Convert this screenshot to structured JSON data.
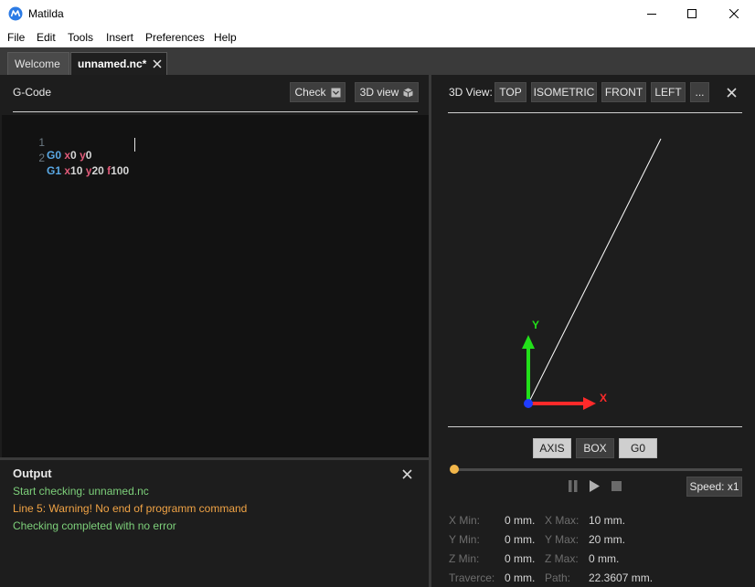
{
  "window": {
    "title": "Matilda"
  },
  "menu": [
    "File",
    "Edit",
    "Tools",
    "Insert",
    "Preferences",
    "Help"
  ],
  "tabs": [
    {
      "label": "Welcome",
      "active": false
    },
    {
      "label": "unnamed.nc*",
      "active": true
    }
  ],
  "gcode_panel": {
    "title": "G-Code",
    "check_label": "Check",
    "view3d_label": "3D view"
  },
  "code_lines": [
    {
      "number": "1",
      "tokens": [
        {
          "t": "G0",
          "k": "g"
        },
        {
          "t": " ",
          "k": "v"
        },
        {
          "t": "x",
          "k": "x"
        },
        {
          "t": "0",
          "k": "v"
        },
        {
          "t": " ",
          "k": "v"
        },
        {
          "t": "y",
          "k": "x"
        },
        {
          "t": "0",
          "k": "v"
        }
      ]
    },
    {
      "number": "2",
      "tokens": [
        {
          "t": "G1",
          "k": "g"
        },
        {
          "t": " ",
          "k": "v"
        },
        {
          "t": "x",
          "k": "x"
        },
        {
          "t": "10",
          "k": "v"
        },
        {
          "t": " ",
          "k": "v"
        },
        {
          "t": "y",
          "k": "x"
        },
        {
          "t": "20",
          "k": "v"
        },
        {
          "t": " ",
          "k": "v"
        },
        {
          "t": "f",
          "k": "x"
        },
        {
          "t": "100",
          "k": "v"
        }
      ]
    }
  ],
  "output_panel": {
    "title": "Output",
    "lines": [
      {
        "text": "Start checking: unnamed.nc",
        "color": "#7dd07a"
      },
      {
        "text": "Line 5:  Warning! No end of programm command",
        "color": "#f0a345"
      },
      {
        "text": "Checking completed with no error",
        "color": "#7dd07a"
      }
    ]
  },
  "view3d_panel": {
    "label": "3D View:",
    "views": [
      "TOP",
      "ISOMETRIC",
      "FRONT",
      "LEFT",
      "..."
    ],
    "toggles": [
      "AXIS",
      "BOX",
      "G0"
    ],
    "speed_label": "Speed: x1",
    "axis_x_label": "X",
    "axis_y_label": "Y",
    "colors": {
      "x_axis": "#ff2a2a",
      "y_axis": "#22e01a",
      "origin": "#1f3cff",
      "path": "#ffffff",
      "progress": "#f2b64a"
    },
    "progress": 0.0
  },
  "stats": [
    {
      "key": "X Min:",
      "value": "0 mm.",
      "key2": "X Max:",
      "value2": "10 mm."
    },
    {
      "key": "Y Min:",
      "value": "0 mm.",
      "key2": "Y Max:",
      "value2": "20 mm."
    },
    {
      "key": "Z Min:",
      "value": "0 mm.",
      "key2": "Z Max:",
      "value2": "0 mm."
    },
    {
      "key": "Traverce:",
      "value": "0 mm.",
      "key2": "Path:",
      "value2": "22.3607 mm."
    }
  ]
}
